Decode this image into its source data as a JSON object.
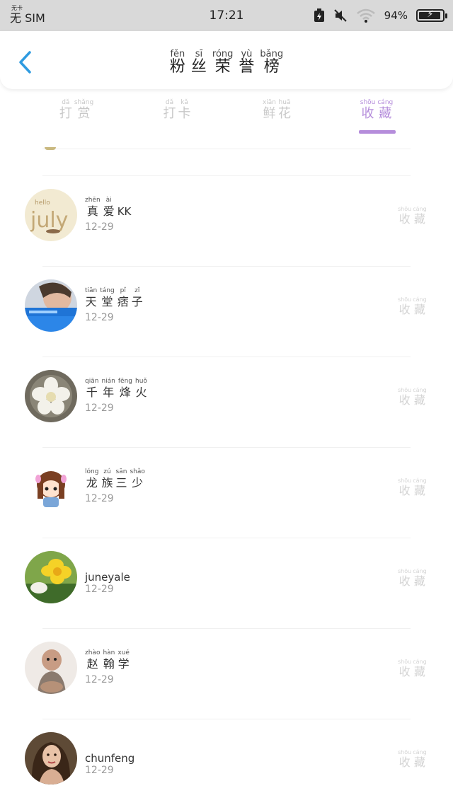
{
  "status_bar": {
    "carrier_small": "无卡",
    "carrier": "无 SIM",
    "time": "17:21",
    "battery_pct": "94%",
    "battery_level": 0.94,
    "bolt": "⚡"
  },
  "header": {
    "title_chars": [
      {
        "py": "fěn",
        "hz": "粉"
      },
      {
        "py": "sī",
        "hz": "丝"
      },
      {
        "py": "róng",
        "hz": "荣"
      },
      {
        "py": "yù",
        "hz": "誉"
      },
      {
        "py": "bǎng",
        "hz": "榜"
      }
    ]
  },
  "tabs": [
    {
      "chars": [
        {
          "py": "dǎ",
          "hz": "打"
        },
        {
          "py": "shǎng",
          "hz": "赏"
        }
      ],
      "active": false
    },
    {
      "chars": [
        {
          "py": "dǎ",
          "hz": "打"
        },
        {
          "py": "kǎ",
          "hz": "卡"
        }
      ],
      "active": false
    },
    {
      "chars": [
        {
          "py": "xiān",
          "hz": "鲜"
        },
        {
          "py": "huā",
          "hz": "花"
        }
      ],
      "active": false
    },
    {
      "chars": [
        {
          "py": "shōu",
          "hz": "收"
        },
        {
          "py": "cáng",
          "hz": "藏"
        }
      ],
      "active": true
    }
  ],
  "list": {
    "action_chars": [
      {
        "py": "shōu",
        "hz": "收"
      },
      {
        "py": "cáng",
        "hz": "藏"
      }
    ],
    "items": [
      {
        "name_chars": [
          {
            "py": "zhēn",
            "hz": "真"
          },
          {
            "py": "ài",
            "hz": "爱"
          }
        ],
        "name_suffix": "KK",
        "date": "12-29",
        "avatar_text": "july"
      },
      {
        "name_chars": [
          {
            "py": "tiān",
            "hz": "天"
          },
          {
            "py": "táng",
            "hz": "堂"
          },
          {
            "py": "pǐ",
            "hz": "痞"
          },
          {
            "py": "zǐ",
            "hz": "子"
          }
        ],
        "name_suffix": "",
        "date": "12-29",
        "avatar_text": ""
      },
      {
        "name_chars": [
          {
            "py": "qiān",
            "hz": "千"
          },
          {
            "py": "nián",
            "hz": "年"
          },
          {
            "py": "fēng",
            "hz": "烽"
          },
          {
            "py": "huǒ",
            "hz": "火"
          }
        ],
        "name_suffix": "",
        "date": "12-29",
        "avatar_text": ""
      },
      {
        "name_chars": [
          {
            "py": "lóng",
            "hz": "龙"
          },
          {
            "py": "zú",
            "hz": "族"
          },
          {
            "py": "sān",
            "hz": "三"
          },
          {
            "py": "shǎo",
            "hz": "少"
          }
        ],
        "name_suffix": "",
        "date": "12-29",
        "avatar_text": ""
      },
      {
        "name_chars": [],
        "name_suffix": "juneyale",
        "date": "12-29",
        "avatar_text": ""
      },
      {
        "name_chars": [
          {
            "py": "zhào",
            "hz": "赵"
          },
          {
            "py": "hàn",
            "hz": "翰"
          },
          {
            "py": "xué",
            "hz": "学"
          }
        ],
        "name_suffix": "",
        "date": "12-29",
        "avatar_text": ""
      },
      {
        "name_chars": [],
        "name_suffix": "chunfeng",
        "date": "12-29",
        "avatar_text": ""
      }
    ]
  },
  "colors": {
    "accent": "#b58ddb",
    "back": "#2f9be0",
    "inactive_tab": "#c8c8c8"
  }
}
